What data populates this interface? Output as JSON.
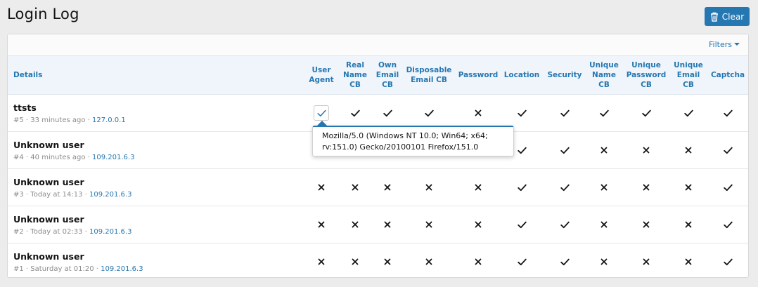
{
  "page": {
    "title": "Login Log",
    "clear_label": "Clear",
    "filters_label": "Filters"
  },
  "columns": [
    {
      "key": "details",
      "label": "Details"
    },
    {
      "key": "user_agent",
      "lines": [
        "User",
        "Agent"
      ]
    },
    {
      "key": "real_name_cb",
      "lines": [
        "Real",
        "Name",
        "CB"
      ]
    },
    {
      "key": "own_email_cb",
      "lines": [
        "Own",
        "Email",
        "CB"
      ]
    },
    {
      "key": "disposable_email_cb",
      "lines": [
        "Disposable",
        "Email CB"
      ]
    },
    {
      "key": "password",
      "lines": [
        "Password"
      ]
    },
    {
      "key": "location",
      "lines": [
        "Location"
      ]
    },
    {
      "key": "security",
      "lines": [
        "Security"
      ]
    },
    {
      "key": "unique_name_cb",
      "lines": [
        "Unique",
        "Name",
        "CB"
      ]
    },
    {
      "key": "unique_password_cb",
      "lines": [
        "Unique",
        "Password",
        "CB"
      ]
    },
    {
      "key": "unique_email_cb",
      "lines": [
        "Unique",
        "Email",
        "CB"
      ]
    },
    {
      "key": "captcha",
      "lines": [
        "Captcha"
      ]
    }
  ],
  "rows": [
    {
      "name": "ttsts",
      "id": "#5",
      "when": "33 minutes ago",
      "ip": "127.0.0.1",
      "checks": [
        "ua",
        "check",
        "check",
        "check",
        "cross",
        "check",
        "check",
        "check",
        "check",
        "check",
        "check"
      ]
    },
    {
      "name": "Unknown user",
      "id": "#4",
      "when": "40 minutes ago",
      "ip": "109.201.6.3",
      "checks": [
        "hidden",
        "hidden",
        "hidden",
        "hidden",
        "hidden",
        "check",
        "check",
        "cross",
        "cross",
        "cross",
        "check"
      ]
    },
    {
      "name": "Unknown user",
      "id": "#3",
      "when": "Today at 14:13",
      "ip": "109.201.6.3",
      "checks": [
        "cross",
        "cross",
        "cross",
        "cross",
        "cross",
        "check",
        "check",
        "cross",
        "cross",
        "cross",
        "check"
      ]
    },
    {
      "name": "Unknown user",
      "id": "#2",
      "when": "Today at 02:33",
      "ip": "109.201.6.3",
      "checks": [
        "cross",
        "cross",
        "cross",
        "cross",
        "cross",
        "check",
        "check",
        "cross",
        "cross",
        "cross",
        "check"
      ]
    },
    {
      "name": "Unknown user",
      "id": "#1",
      "when": "Saturday at 01:20",
      "ip": "109.201.6.3",
      "checks": [
        "cross",
        "cross",
        "cross",
        "cross",
        "cross",
        "check",
        "check",
        "cross",
        "cross",
        "cross",
        "check"
      ]
    }
  ],
  "tooltip": {
    "line1": "Mozilla/5.0 (Windows NT 10.0; Win64; x64;",
    "line2": "rv:151.0) Gecko/20100101 Firefox/151.0"
  },
  "icons": {
    "clear": "trash-icon",
    "filters": "caret-down-icon",
    "yes": "check-icon",
    "no": "cross-icon"
  },
  "colors": {
    "accent": "#2577b1",
    "header_bg": "#f0f5fb",
    "page_bg": "#ececec"
  }
}
